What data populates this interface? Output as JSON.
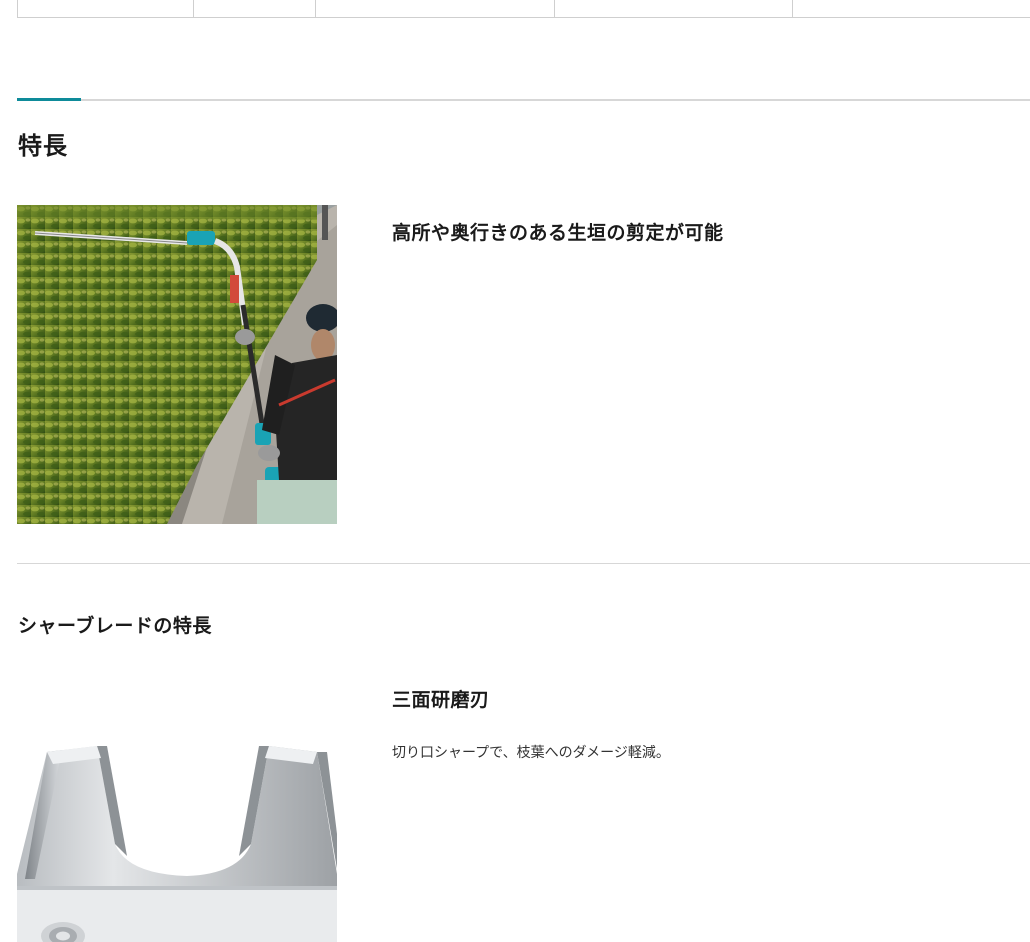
{
  "spec_table": {
    "cells": [
      "",
      "",
      "",
      "",
      "",
      ""
    ]
  },
  "features_section": {
    "title": "特長",
    "feature_1": {
      "heading": "高所や奥行きのある生垣の剪定が可能",
      "image_icon": "hedge-trimming-photo"
    }
  },
  "blade_section": {
    "title": "シャーブレードの特長",
    "feature_1": {
      "heading": "三面研磨刃",
      "description": "切り口シャープで、枝葉へのダメージ軽減。",
      "image_icon": "blade-closeup-photo"
    }
  },
  "colors": {
    "accent": "#0e8b9a",
    "divider": "#d7d7d7"
  }
}
